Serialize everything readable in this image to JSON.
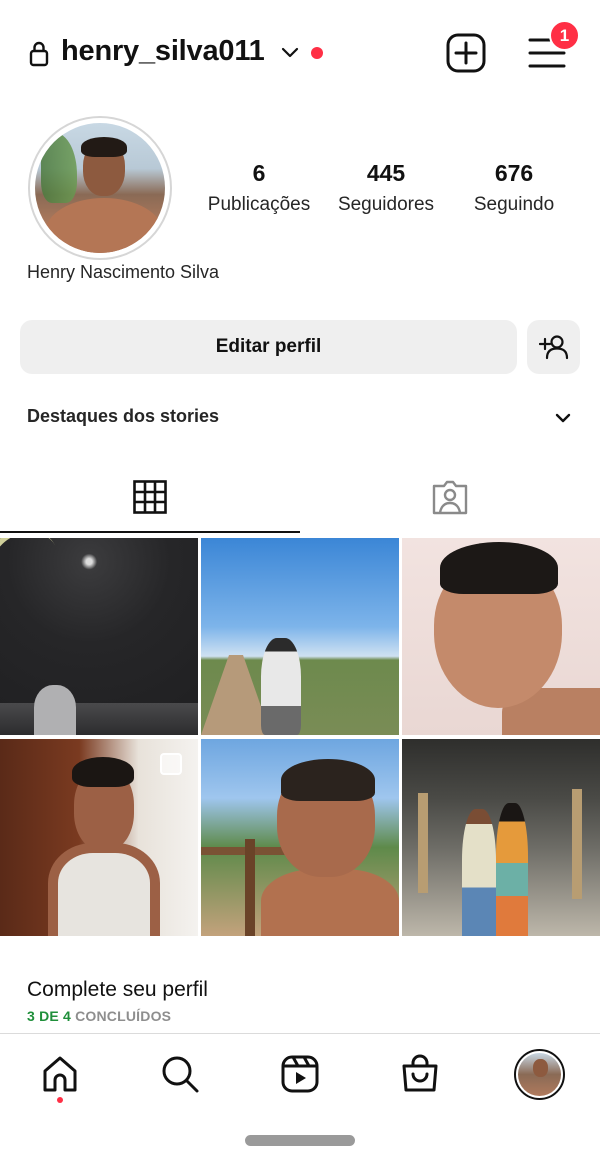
{
  "header": {
    "username": "henry_silva011",
    "notification_count": "1",
    "icons": [
      "lock-icon",
      "chevron-down-icon",
      "add-post-icon",
      "menu-icon"
    ]
  },
  "profile": {
    "full_name": "Henry Nascimento Silva",
    "stats": [
      {
        "value": "6",
        "label": "Publicações"
      },
      {
        "value": "445",
        "label": "Seguidores"
      },
      {
        "value": "676",
        "label": "Seguindo"
      }
    ]
  },
  "actions": {
    "edit_profile": "Editar perfil",
    "add_user_icon": "person-add-icon"
  },
  "highlights": {
    "label": "Destaques dos stories"
  },
  "tabs": [
    {
      "name": "posts-grid",
      "icon": "grid-icon",
      "active": true
    },
    {
      "name": "tagged",
      "icon": "tagged-person-icon",
      "active": false
    }
  ],
  "posts": [
    {
      "id": "post-1",
      "multiple": false
    },
    {
      "id": "post-2",
      "multiple": false
    },
    {
      "id": "post-3",
      "multiple": false
    },
    {
      "id": "post-4",
      "multiple": true
    },
    {
      "id": "post-5",
      "multiple": false
    },
    {
      "id": "post-6",
      "multiple": false
    }
  ],
  "complete_profile": {
    "title": "Complete seu perfil",
    "progress_done": "3 DE 4",
    "progress_label": "CONCLUÍDOS"
  },
  "bottom_nav": [
    {
      "name": "home",
      "icon": "home-icon"
    },
    {
      "name": "search",
      "icon": "search-icon"
    },
    {
      "name": "reels",
      "icon": "reels-icon"
    },
    {
      "name": "shop",
      "icon": "shopping-bag-icon"
    },
    {
      "name": "profile",
      "icon": "avatar"
    }
  ],
  "colors": {
    "accent_red": "#ff2f45",
    "button_bg": "#efefef",
    "progress_green": "#1f8f3a"
  }
}
